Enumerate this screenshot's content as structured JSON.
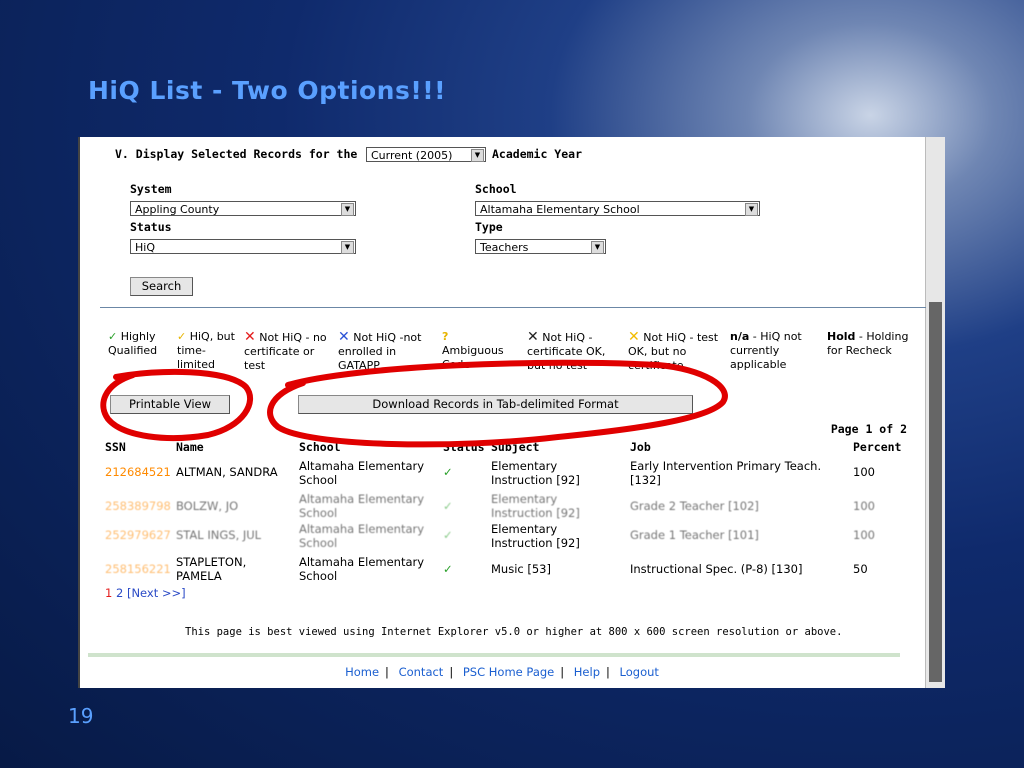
{
  "slide": {
    "title": "HiQ List - Two Options!!!",
    "number": "19"
  },
  "form": {
    "section_title": "V. Display Selected Records for the",
    "year_select": "Current (2005)",
    "year_suffix": "Academic Year",
    "system_label": "System",
    "system_value": "Appling County",
    "school_label": "School",
    "school_value": "Altamaha Elementary School",
    "status_label": "Status",
    "status_value": "HiQ",
    "type_label": "Type",
    "type_value": "Teachers",
    "search_label": "Search"
  },
  "legend": [
    {
      "icon": "check-green-icon",
      "text": "Highly Qualified"
    },
    {
      "icon": "check-yellow-icon",
      "text": "HiQ, but time-limited"
    },
    {
      "icon": "x-red-icon",
      "text": "Not HiQ - no certificate or test"
    },
    {
      "icon": "x-blue-icon",
      "text": "Not HiQ -not enrolled in GATAPP"
    },
    {
      "icon": "question-yellow-icon",
      "text": "Ambiguous Code"
    },
    {
      "icon": "x-dark-icon",
      "text": "Not HiQ - certificate OK, but no test"
    },
    {
      "icon": "x-yellow-icon",
      "text": "Not HiQ - test OK, but no certificate"
    },
    {
      "bold": "n/a",
      "text": " - HiQ not currently applicable"
    },
    {
      "bold": "Hold",
      "text": " - Holding for Recheck"
    }
  ],
  "actions": {
    "printable": "Printable View",
    "download": "Download Records in Tab-delimited Format"
  },
  "page_info": "Page 1 of 2",
  "table": {
    "headers": [
      "SSN",
      "Name",
      "School",
      "Status",
      "Subject",
      "Job",
      "Percent"
    ],
    "rows": [
      {
        "ssn": "212684521",
        "name": "ALTMAN, SANDRA",
        "school": "Altamaha Elementary School",
        "subject": "Elementary Instruction [92]",
        "job": "Early Intervention Primary Teach. [132]",
        "percent": "100"
      },
      {
        "ssn": "258389798",
        "name": "BOLZW, JO",
        "school": "Altamaha Elementary School",
        "subject": "Elementary Instruction [92]",
        "job": "Grade 2 Teacher [102]",
        "percent": "100"
      },
      {
        "ssn": "252979627",
        "name": "STAL INGS, JUL",
        "school": "Altamaha Elementary School",
        "subject": "Elementary Instruction [92]",
        "job": "Grade 1 Teacher [101]",
        "percent": "100"
      },
      {
        "ssn": "258156221",
        "name": "STAPLETON, PAMELA",
        "school": "Altamaha Elementary School",
        "subject": "Music [53]",
        "job": "Instructional Spec. (P-8) [130]",
        "percent": "50"
      }
    ]
  },
  "pager": {
    "current": "1",
    "page2": "2",
    "next": "[Next >>]"
  },
  "note": "This page is best viewed using Internet Explorer v5.0 or higher at 800 x 600 screen resolution or above.",
  "footer_links": [
    "Home",
    "Contact",
    "PSC Home Page",
    "Help",
    "Logout"
  ],
  "colors": {
    "title": "#5aa0ff",
    "annotation": "#e00000",
    "ssn": "#ff8a00",
    "link": "#1b5fd0"
  }
}
